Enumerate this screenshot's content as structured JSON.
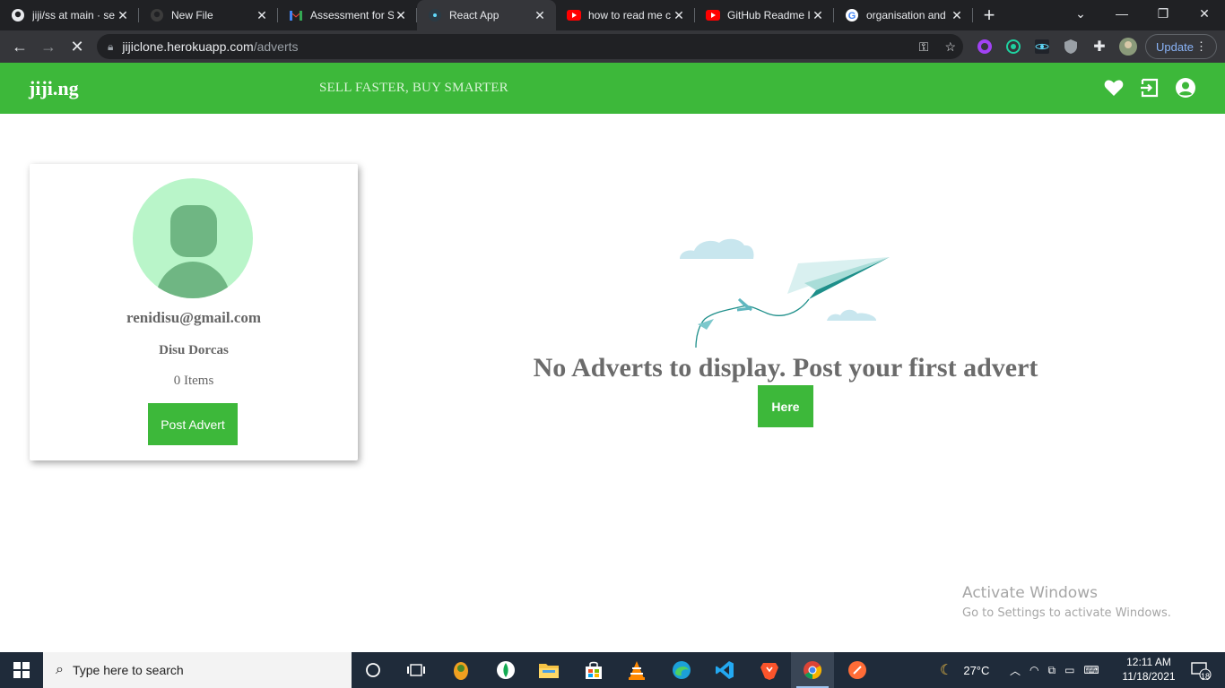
{
  "browser": {
    "tabs": [
      {
        "title": "jiji/ss at main · se",
        "icon": "github-icon"
      },
      {
        "title": "New File",
        "icon": "github-icon"
      },
      {
        "title": "Assessment for S",
        "icon": "gmail-icon"
      },
      {
        "title": "React App",
        "icon": "react-icon",
        "active": true
      },
      {
        "title": "how to read me c",
        "icon": "youtube-icon"
      },
      {
        "title": "GitHub Readme I",
        "icon": "youtube-icon"
      },
      {
        "title": "organisation and",
        "icon": "google-icon"
      }
    ],
    "url_domain": "jijiclone.herokuapp.com",
    "url_path": "/adverts",
    "update_label": "Update"
  },
  "header": {
    "brand": "jiji.ng",
    "tagline": "SELL FASTER, BUY SMARTER"
  },
  "profile": {
    "email": "renidisu@gmail.com",
    "name": "Disu Dorcas",
    "items": "0 Items",
    "post_button": "Post Advert"
  },
  "empty_state": {
    "message": "No Adverts to display. Post your first advert",
    "button": "Here"
  },
  "watermark": {
    "title": "Activate Windows",
    "subtitle": "Go to Settings to activate Windows."
  },
  "taskbar": {
    "search_placeholder": "Type here to search",
    "temperature": "27°C",
    "time": "12:11 AM",
    "date": "11/18/2021",
    "notifications": "18"
  },
  "colors": {
    "brand_green": "#3db83a",
    "avatar_bg": "#b9f5c9",
    "avatar_fg": "#6fb683"
  }
}
